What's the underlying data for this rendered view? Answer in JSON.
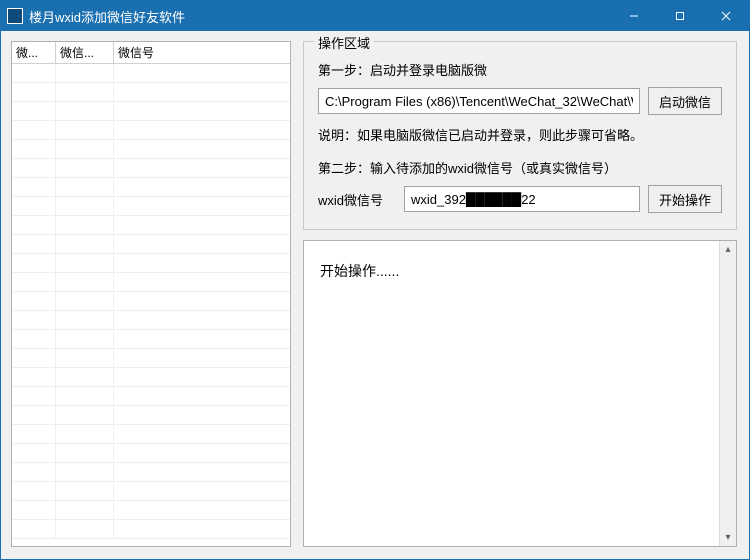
{
  "window": {
    "title": "楼月wxid添加微信好友软件"
  },
  "table": {
    "columns": [
      "微...",
      "微信...",
      "微信号"
    ]
  },
  "ops": {
    "legend": "操作区域",
    "step1_label": "第一步：启动并登录电脑版微",
    "path_value": "C:\\Program Files (x86)\\Tencent\\WeChat_32\\WeChat\\W",
    "launch_btn": "启动微信",
    "note": "说明：如果电脑版微信已启动并登录，则此步骤可省略。",
    "step2_label": "第二步：输入待添加的wxid微信号（或真实微信号）",
    "wxid_label": "wxid微信号",
    "wxid_value": "wxid_392██████22",
    "start_btn": "开始操作"
  },
  "log": {
    "content": "开始操作......"
  }
}
